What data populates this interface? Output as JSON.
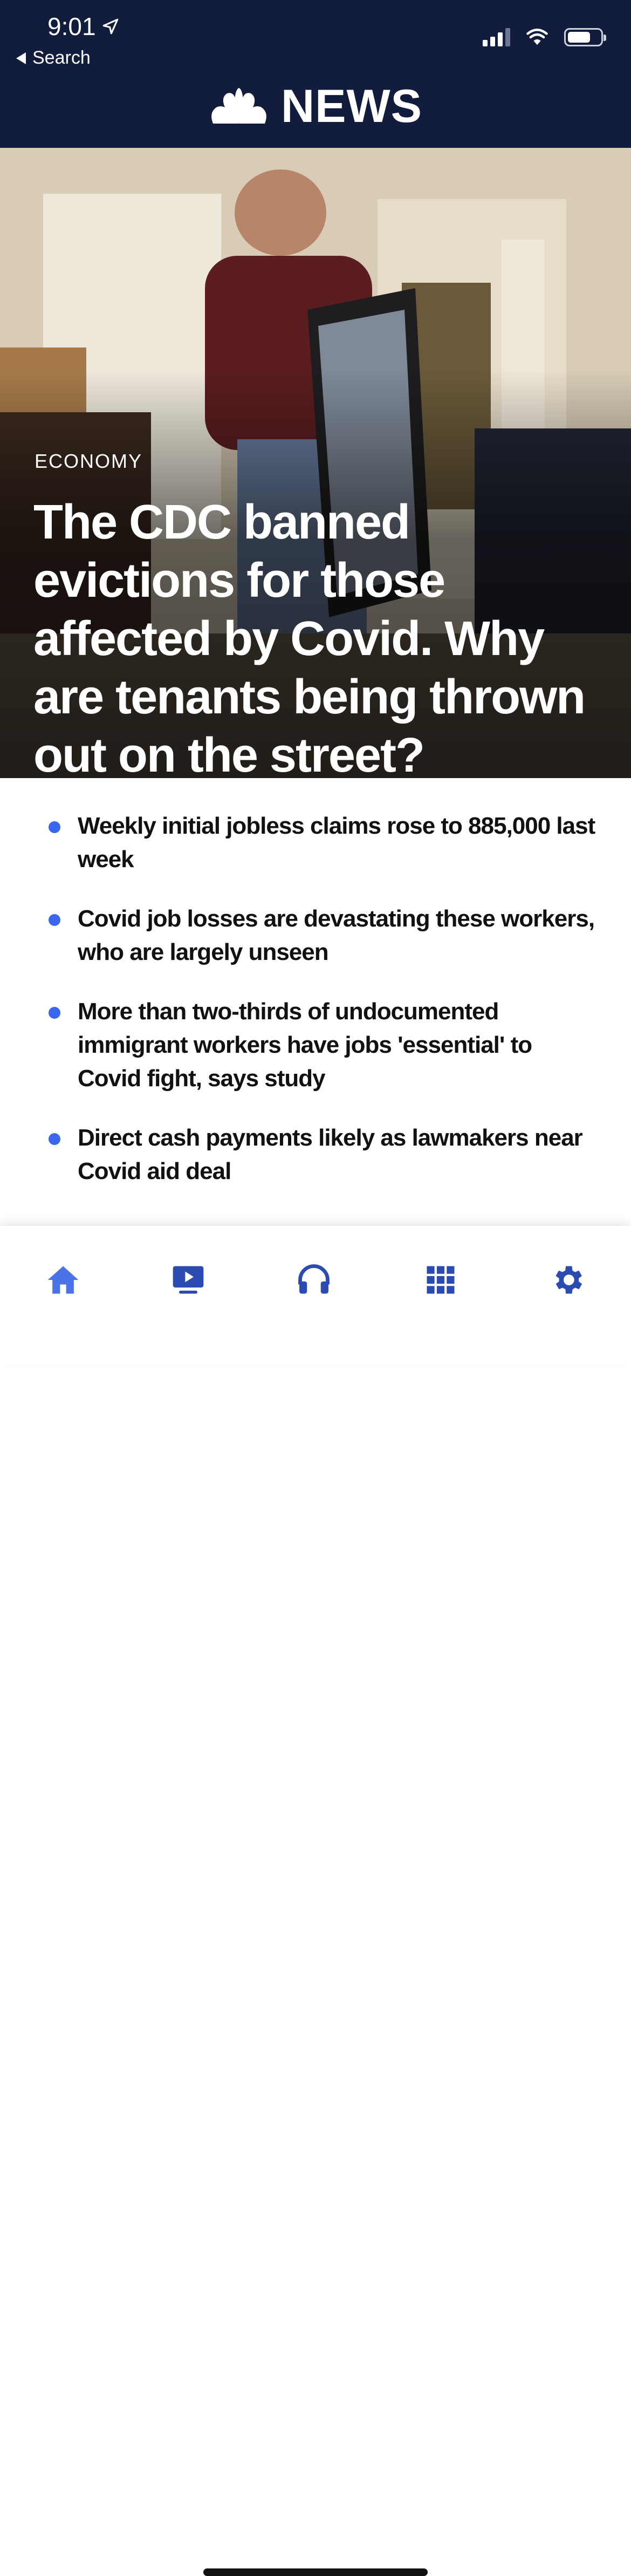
{
  "status_bar": {
    "time": "9:01",
    "back_label": "Search"
  },
  "header": {
    "wordmark": "NEWS"
  },
  "hero": {
    "category": "ECONOMY",
    "headline": "The CDC banned evictions for those affected by Covid. Why are tenants being thrown out on the street?"
  },
  "bullets": [
    "Weekly initial jobless claims rose to 885,000 last week",
    "Covid job losses are devastating these workers, who are largely unseen",
    "More than two-thirds of undocumented immigrant workers have jobs 'essential' to Covid fight, says study",
    "Direct cash payments likely as lawmakers near Covid aid deal"
  ],
  "tabbar": {
    "items": [
      {
        "icon": "home-icon",
        "active": true
      },
      {
        "icon": "video-icon",
        "active": false
      },
      {
        "icon": "headphones-icon",
        "active": false
      },
      {
        "icon": "grid-icon",
        "active": false
      },
      {
        "icon": "gear-icon",
        "active": false
      }
    ]
  },
  "colors": {
    "header_bg": "#121c3c",
    "accent_blue": "#3b66f0",
    "tab_blue": "#2b4bb0",
    "home_active": "#4a73e8"
  }
}
